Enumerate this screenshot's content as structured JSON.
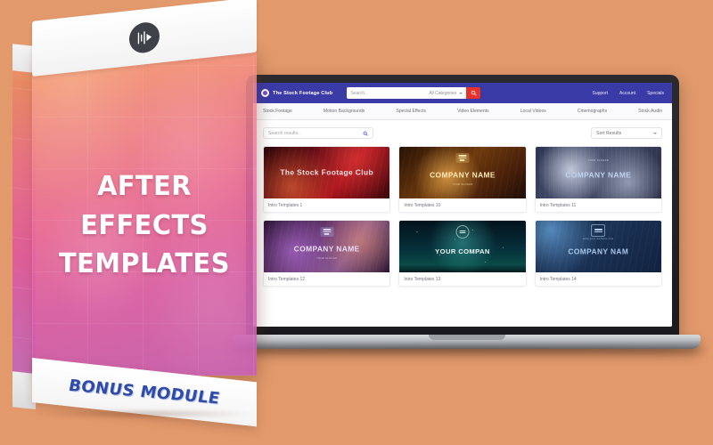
{
  "background_color": "#e2996b",
  "product_box": {
    "title_line1": "AFTER EFFECTS",
    "title_line2": "TEMPLATES",
    "bonus_label": "BONUS MODULE",
    "logo_icon": "waveform-play-logo-icon",
    "colors": {
      "face_gradient_start": "#f5965a",
      "face_gradient_end": "#c45cb0",
      "bonus_text": "#2e4ba8",
      "box_white": "#ffffff"
    }
  },
  "laptop": {
    "bezel_color": "#22222a",
    "base_color": "#b9bcc1"
  },
  "site": {
    "topbar": {
      "brand_name": "The Stock Footage Club",
      "brand_logo_icon": "circle-logo-icon",
      "search_placeholder": "Search..",
      "category_selected": "All Categories",
      "search_button_icon": "search-icon",
      "search_button_color": "#e8322c",
      "bar_color": "#3b3ba8",
      "links": [
        {
          "label": "Support"
        },
        {
          "label": "Account"
        },
        {
          "label": "Specials"
        }
      ]
    },
    "mainnav": {
      "items": [
        {
          "label": "Stock Footage"
        },
        {
          "label": "Motion Backgrounds"
        },
        {
          "label": "Special Effects"
        },
        {
          "label": "Video Elements"
        },
        {
          "label": "Local Videos"
        },
        {
          "label": "Cinemographs"
        },
        {
          "label": "Stock Audio"
        }
      ]
    },
    "toolbar": {
      "results_search_placeholder": "Search results..",
      "results_search_icon": "search-icon",
      "sort_label": "Sort Results",
      "sort_caret_icon": "chevron-down-icon"
    },
    "results": [
      {
        "caption": "Intro Templates 1",
        "thumb_text": "The Stock Footage Club",
        "thumb_sub": "",
        "text_color": "#f3dede",
        "art": "art1",
        "has_logo": false,
        "overlay": "streaks"
      },
      {
        "caption": "Intro Templates 10",
        "thumb_text": "COMPANY NAME",
        "thumb_sub": "YOUR SLOGAN",
        "text_color": "#ffe7b4",
        "art": "art2",
        "has_logo": true,
        "overlay": "streaks"
      },
      {
        "caption": "Intro Templates 11",
        "thumb_text": "COMPANY NAME",
        "thumb_sub": "YOUR SLOGAN",
        "text_color": "#bfd2ee",
        "art": "art3",
        "has_logo": false,
        "overlay": "vstripes"
      },
      {
        "caption": "Intro Templates 12",
        "thumb_text": "COMPANY NAME",
        "thumb_sub": "YOUR SLOGAN",
        "text_color": "#e9dcf5",
        "art": "art4",
        "has_logo": true,
        "overlay": "streaks"
      },
      {
        "caption": "Intro Templates 13",
        "thumb_text": "YOUR COMPAN",
        "thumb_sub": "YOUR LOGO",
        "text_color": "#eef6f6",
        "art": "art5",
        "has_logo": true,
        "overlay": "specks"
      },
      {
        "caption": "Intro Templates 14",
        "thumb_text": "COMPANY NAM",
        "thumb_sub": "www.your-website.com",
        "text_color": "#a9c6e8",
        "art": "art6",
        "has_logo": true,
        "overlay": "streaks"
      }
    ]
  }
}
